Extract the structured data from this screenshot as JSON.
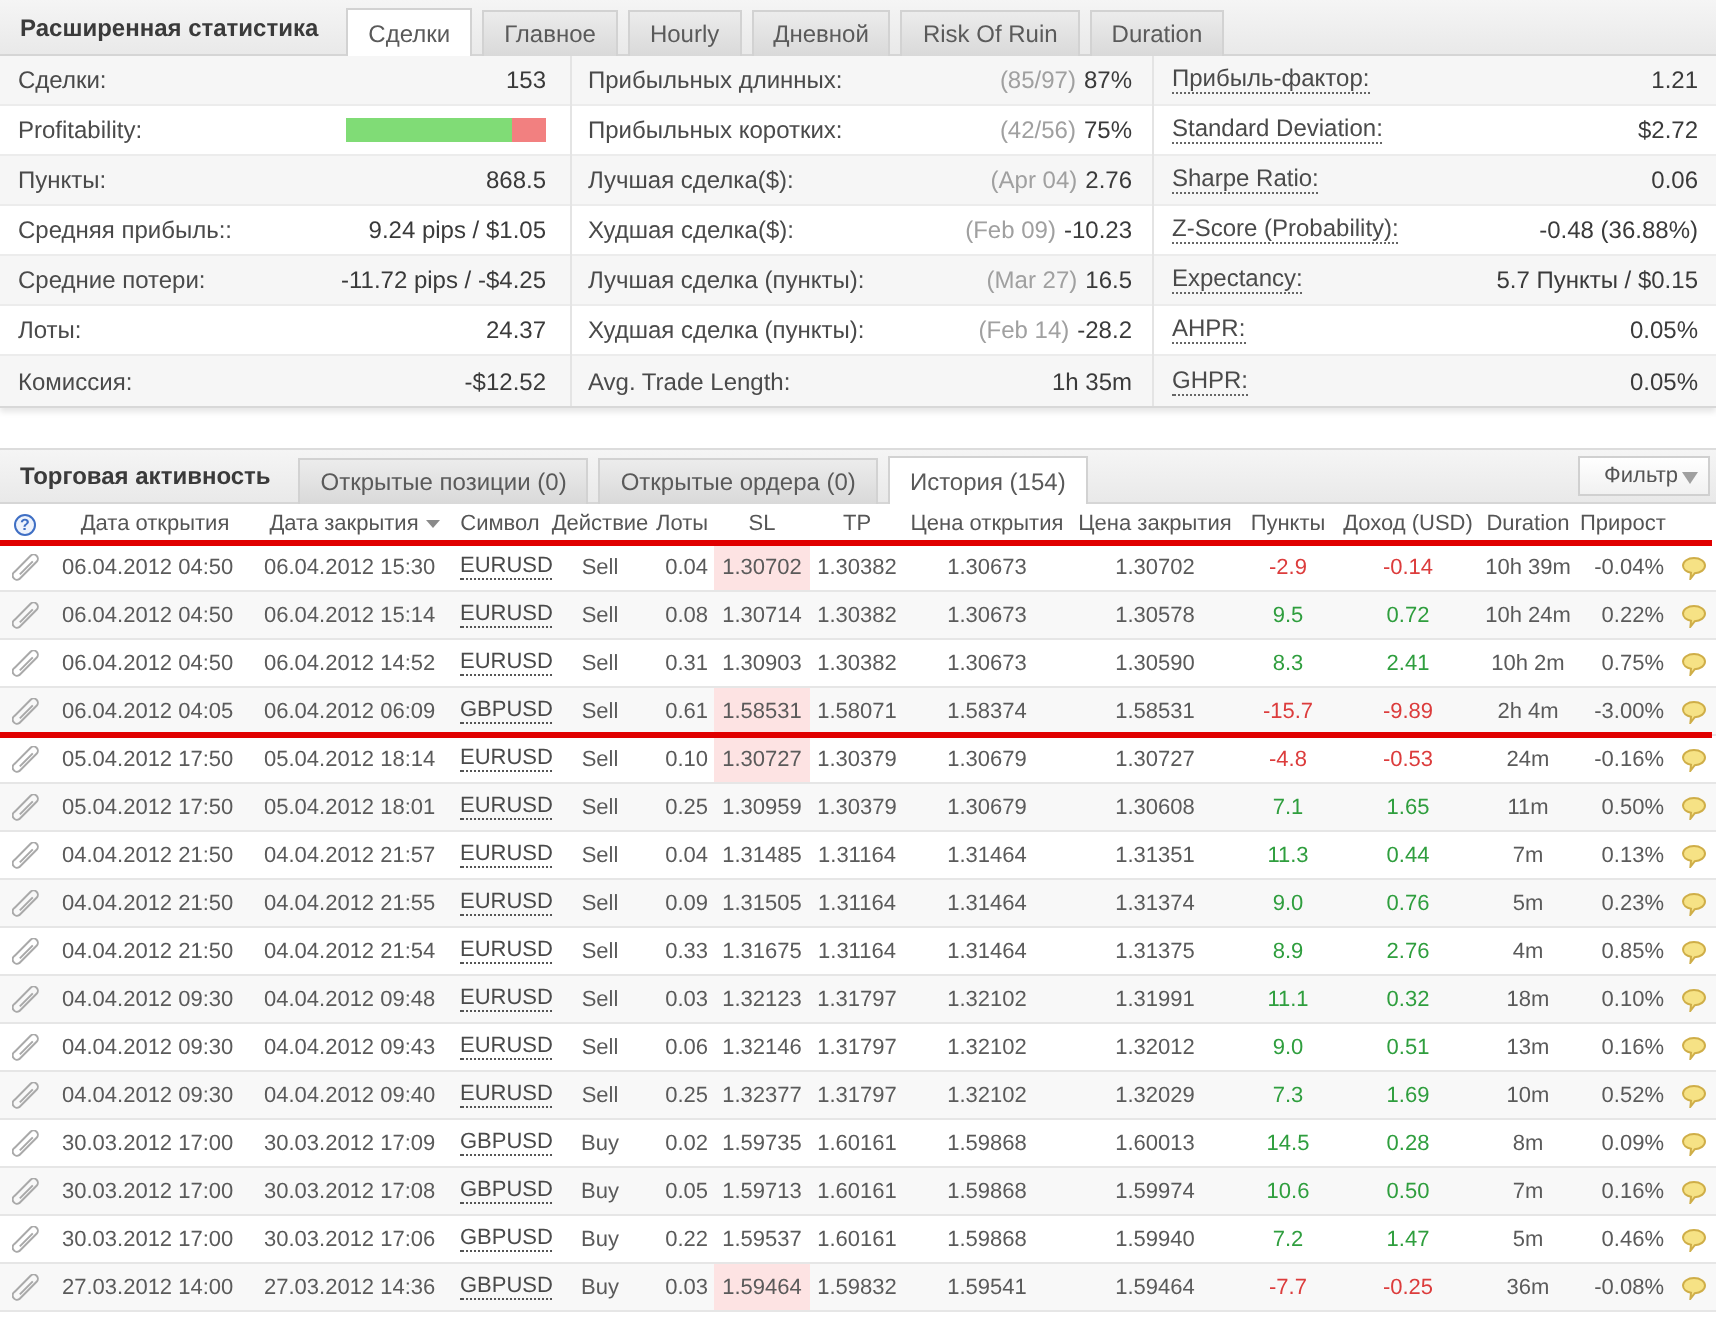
{
  "stats_panel": {
    "title": "Расширенная статистика",
    "tabs": [
      {
        "label": "Сделки",
        "selected": true
      },
      {
        "label": "Главное",
        "selected": false
      },
      {
        "label": "Hourly",
        "selected": false
      },
      {
        "label": "Дневной",
        "selected": false
      },
      {
        "label": "Risk Of Ruin",
        "selected": false
      },
      {
        "label": "Duration",
        "selected": false
      }
    ]
  },
  "stats": {
    "column_1": [
      {
        "kind": "text",
        "label": "Сделки:",
        "value": "153"
      },
      {
        "kind": "bar",
        "label": "Profitability:",
        "level": 0.83
      },
      {
        "kind": "text",
        "label": "Пункты:",
        "value": "868.5"
      },
      {
        "kind": "text",
        "label": "Средняя прибыль::",
        "value": "9.24 pips / $1.05"
      },
      {
        "kind": "text",
        "label": "Средние потери:",
        "value": "-11.72 pips / -$4.25"
      },
      {
        "kind": "text",
        "label": "Лоты:",
        "value": "24.37"
      },
      {
        "kind": "text",
        "label": "Комиссия:",
        "value": "-$12.52"
      }
    ],
    "column_2": [
      {
        "label": "Прибыльных длинных:",
        "note": "(85/97)",
        "value": "87%"
      },
      {
        "label": "Прибыльных коротких:",
        "note": "(42/56)",
        "value": "75%"
      },
      {
        "label": "Лучшая сделка($):",
        "note": "(Apr 04)",
        "value": "2.76"
      },
      {
        "label": "Худшая сделка($):",
        "note": "(Feb 09)",
        "value": "-10.23"
      },
      {
        "label": "Лучшая сделка (пункты):",
        "note": "(Mar 27)",
        "value": "16.5"
      },
      {
        "label": "Худшая сделка (пункты):",
        "note": "(Feb 14)",
        "value": "-28.2"
      },
      {
        "label": "Avg. Trade Length:",
        "value": "1h 35m"
      }
    ],
    "column_3": [
      {
        "label": "Прибыль-фактор:",
        "value": "1.21"
      },
      {
        "label": "Standard Deviation:",
        "value": "$2.72"
      },
      {
        "label": "Sharpe Ratio:",
        "value": "0.06"
      },
      {
        "label": "Z-Score (Probability):",
        "value": "-0.48 (36.88%)"
      },
      {
        "label": "Expectancy:",
        "value": "5.7 Пункты / $0.15"
      },
      {
        "label": "AHPR:",
        "value": "0.05%"
      },
      {
        "label": "GHPR:",
        "value": "0.05%"
      }
    ]
  },
  "activity": {
    "title": "Торговая активность",
    "tabs": [
      {
        "label": "Открытые позиции (0)",
        "selected": false
      },
      {
        "label": "Открытые ордера (0)",
        "selected": false
      },
      {
        "label": "История (154)",
        "selected": true
      }
    ],
    "filter_button": "Фильтр"
  },
  "history": {
    "help": "?",
    "columns": [
      {
        "label": "Дата открытия",
        "sorted": false
      },
      {
        "label": "Дата закрытия",
        "sorted": true
      },
      {
        "label": "Символ",
        "sorted": false
      },
      {
        "label": "Действие",
        "sorted": false
      },
      {
        "label": "Лоты",
        "sorted": false
      },
      {
        "label": "SL",
        "sorted": false
      },
      {
        "label": "TP",
        "sorted": false
      },
      {
        "label": "Цена открытия",
        "sorted": false
      },
      {
        "label": "Цена закрытия",
        "sorted": false
      },
      {
        "label": "Пункты",
        "sorted": false
      },
      {
        "label": "Доход (USD)",
        "sorted": false
      },
      {
        "label": "Duration",
        "sorted": false
      },
      {
        "label": "Прирост",
        "sorted": false
      }
    ],
    "rows": [
      {
        "open": "06.04.2012 04:50",
        "close": "06.04.2012 15:30",
        "symbol": "EURUSD",
        "action": "Sell",
        "lots": "0.04",
        "sl": "1.30702",
        "sl_hit": true,
        "tp": "1.30382",
        "open_price": "1.30673",
        "close_price": "1.30702",
        "points": "-2.9",
        "profit": "-0.14",
        "profitable": false,
        "duration": "10h 39m",
        "growth": "-0.04%",
        "marked": true
      },
      {
        "open": "06.04.2012 04:50",
        "close": "06.04.2012 15:14",
        "symbol": "EURUSD",
        "action": "Sell",
        "lots": "0.08",
        "sl": "1.30714",
        "sl_hit": false,
        "tp": "1.30382",
        "open_price": "1.30673",
        "close_price": "1.30578",
        "points": "9.5",
        "profit": "0.72",
        "profitable": true,
        "duration": "10h 24m",
        "growth": "0.22%",
        "marked": true
      },
      {
        "open": "06.04.2012 04:50",
        "close": "06.04.2012 14:52",
        "symbol": "EURUSD",
        "action": "Sell",
        "lots": "0.31",
        "sl": "1.30903",
        "sl_hit": false,
        "tp": "1.30382",
        "open_price": "1.30673",
        "close_price": "1.30590",
        "points": "8.3",
        "profit": "2.41",
        "profitable": true,
        "duration": "10h 2m",
        "growth": "0.75%",
        "marked": true
      },
      {
        "open": "06.04.2012 04:05",
        "close": "06.04.2012 06:09",
        "symbol": "GBPUSD",
        "action": "Sell",
        "lots": "0.61",
        "sl": "1.58531",
        "sl_hit": true,
        "tp": "1.58071",
        "open_price": "1.58374",
        "close_price": "1.58531",
        "points": "-15.7",
        "profit": "-9.89",
        "profitable": false,
        "duration": "2h 4m",
        "growth": "-3.00%",
        "marked": true
      },
      {
        "open": "05.04.2012 17:50",
        "close": "05.04.2012 18:14",
        "symbol": "EURUSD",
        "action": "Sell",
        "lots": "0.10",
        "sl": "1.30727",
        "sl_hit": true,
        "tp": "1.30379",
        "open_price": "1.30679",
        "close_price": "1.30727",
        "points": "-4.8",
        "profit": "-0.53",
        "profitable": false,
        "duration": "24m",
        "growth": "-0.16%",
        "marked": false
      },
      {
        "open": "05.04.2012 17:50",
        "close": "05.04.2012 18:01",
        "symbol": "EURUSD",
        "action": "Sell",
        "lots": "0.25",
        "sl": "1.30959",
        "sl_hit": false,
        "tp": "1.30379",
        "open_price": "1.30679",
        "close_price": "1.30608",
        "points": "7.1",
        "profit": "1.65",
        "profitable": true,
        "duration": "11m",
        "growth": "0.50%",
        "marked": false
      },
      {
        "open": "04.04.2012 21:50",
        "close": "04.04.2012 21:57",
        "symbol": "EURUSD",
        "action": "Sell",
        "lots": "0.04",
        "sl": "1.31485",
        "sl_hit": false,
        "tp": "1.31164",
        "open_price": "1.31464",
        "close_price": "1.31351",
        "points": "11.3",
        "profit": "0.44",
        "profitable": true,
        "duration": "7m",
        "growth": "0.13%",
        "marked": false
      },
      {
        "open": "04.04.2012 21:50",
        "close": "04.04.2012 21:55",
        "symbol": "EURUSD",
        "action": "Sell",
        "lots": "0.09",
        "sl": "1.31505",
        "sl_hit": false,
        "tp": "1.31164",
        "open_price": "1.31464",
        "close_price": "1.31374",
        "points": "9.0",
        "profit": "0.76",
        "profitable": true,
        "duration": "5m",
        "growth": "0.23%",
        "marked": false
      },
      {
        "open": "04.04.2012 21:50",
        "close": "04.04.2012 21:54",
        "symbol": "EURUSD",
        "action": "Sell",
        "lots": "0.33",
        "sl": "1.31675",
        "sl_hit": false,
        "tp": "1.31164",
        "open_price": "1.31464",
        "close_price": "1.31375",
        "points": "8.9",
        "profit": "2.76",
        "profitable": true,
        "duration": "4m",
        "growth": "0.85%",
        "marked": false
      },
      {
        "open": "04.04.2012 09:30",
        "close": "04.04.2012 09:48",
        "symbol": "EURUSD",
        "action": "Sell",
        "lots": "0.03",
        "sl": "1.32123",
        "sl_hit": false,
        "tp": "1.31797",
        "open_price": "1.32102",
        "close_price": "1.31991",
        "points": "11.1",
        "profit": "0.32",
        "profitable": true,
        "duration": "18m",
        "growth": "0.10%",
        "marked": false
      },
      {
        "open": "04.04.2012 09:30",
        "close": "04.04.2012 09:43",
        "symbol": "EURUSD",
        "action": "Sell",
        "lots": "0.06",
        "sl": "1.32146",
        "sl_hit": false,
        "tp": "1.31797",
        "open_price": "1.32102",
        "close_price": "1.32012",
        "points": "9.0",
        "profit": "0.51",
        "profitable": true,
        "duration": "13m",
        "growth": "0.16%",
        "marked": false
      },
      {
        "open": "04.04.2012 09:30",
        "close": "04.04.2012 09:40",
        "symbol": "EURUSD",
        "action": "Sell",
        "lots": "0.25",
        "sl": "1.32377",
        "sl_hit": false,
        "tp": "1.31797",
        "open_price": "1.32102",
        "close_price": "1.32029",
        "points": "7.3",
        "profit": "1.69",
        "profitable": true,
        "duration": "10m",
        "growth": "0.52%",
        "marked": false
      },
      {
        "open": "30.03.2012 17:00",
        "close": "30.03.2012 17:09",
        "symbol": "GBPUSD",
        "action": "Buy",
        "lots": "0.02",
        "sl": "1.59735",
        "sl_hit": false,
        "tp": "1.60161",
        "open_price": "1.59868",
        "close_price": "1.60013",
        "points": "14.5",
        "profit": "0.28",
        "profitable": true,
        "duration": "8m",
        "growth": "0.09%",
        "marked": false
      },
      {
        "open": "30.03.2012 17:00",
        "close": "30.03.2012 17:08",
        "symbol": "GBPUSD",
        "action": "Buy",
        "lots": "0.05",
        "sl": "1.59713",
        "sl_hit": false,
        "tp": "1.60161",
        "open_price": "1.59868",
        "close_price": "1.59974",
        "points": "10.6",
        "profit": "0.50",
        "profitable": true,
        "duration": "7m",
        "growth": "0.16%",
        "marked": false
      },
      {
        "open": "30.03.2012 17:00",
        "close": "30.03.2012 17:06",
        "symbol": "GBPUSD",
        "action": "Buy",
        "lots": "0.22",
        "sl": "1.59537",
        "sl_hit": false,
        "tp": "1.60161",
        "open_price": "1.59868",
        "close_price": "1.59940",
        "points": "7.2",
        "profit": "1.47",
        "profitable": true,
        "duration": "5m",
        "growth": "0.46%",
        "marked": false
      },
      {
        "open": "27.03.2012 14:00",
        "close": "27.03.2012 14:36",
        "symbol": "GBPUSD",
        "action": "Buy",
        "lots": "0.03",
        "sl": "1.59464",
        "sl_hit": true,
        "tp": "1.59832",
        "open_price": "1.59541",
        "close_price": "1.59464",
        "points": "-7.7",
        "profit": "-0.25",
        "profitable": false,
        "duration": "36m",
        "growth": "-0.08%",
        "marked": false
      }
    ]
  }
}
